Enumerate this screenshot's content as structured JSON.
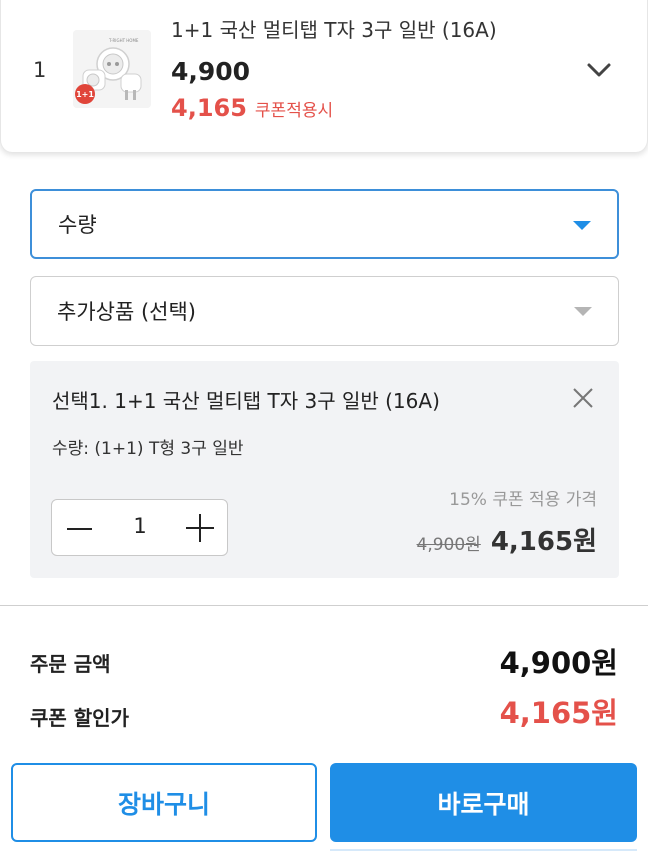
{
  "product": {
    "index": "1",
    "name": "1+1 국산 멀티탭 T자 3구 일반 (16A)",
    "price": "4,900",
    "coupon_price": "4,165",
    "coupon_label": "쿠폰적용시",
    "thumb_badge": "1+1",
    "thumb_brand": "T-RIGHT HOME"
  },
  "selects": {
    "quantity_label": "수량",
    "addon_label": "추가상품 (선택)"
  },
  "option": {
    "title": "선택1. 1+1 국산 멀티탭 T자 3구 일반 (16A)",
    "subtitle": "수량: (1+1) T형 3구 일반",
    "quantity": "1",
    "discount_label": "15% 쿠폰 적용 가격",
    "original_price": "4,900원",
    "final_price": "4,165원"
  },
  "totals": {
    "order_label": "주문 금액",
    "order_value": "4,900원",
    "coupon_label": "쿠폰 할인가",
    "coupon_value": "4,165원"
  },
  "buttons": {
    "cart": "장바구니",
    "buy": "바로구매"
  },
  "colors": {
    "accent": "#1f8ee6",
    "discount": "#e4514a",
    "option_bg": "#f2f3f5"
  }
}
